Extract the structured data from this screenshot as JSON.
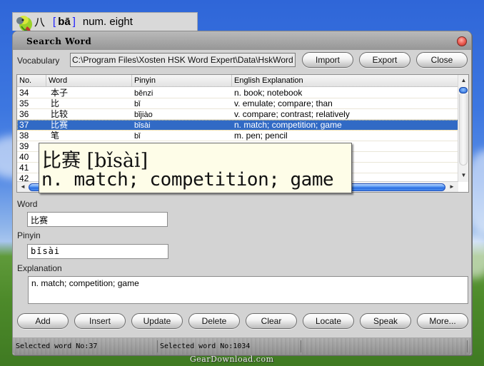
{
  "title_strip": {
    "hanzi": "八",
    "pinyin": "bā",
    "open_bracket": "[",
    "close_bracket": "]",
    "definition": "num. eight",
    "icon": "parrot-icon"
  },
  "window": {
    "title": "Search Word",
    "close_icon": "close-orb-icon"
  },
  "vocabulary": {
    "label": "Vocabulary",
    "path": "C:\\Program Files\\Xosten HSK Word Expert\\Data\\HskWord"
  },
  "toolbar": {
    "import_label": "Import",
    "export_label": "Export",
    "close_label": "Close"
  },
  "list": {
    "columns": [
      "No.",
      "Word",
      "Pinyin",
      "English Explanation"
    ],
    "rows": [
      {
        "no": "34",
        "word": "本子",
        "pinyin": "běnzi",
        "explanation": "n. book; notebook"
      },
      {
        "no": "35",
        "word": "比",
        "pinyin": "bǐ",
        "explanation": "v. emulate; compare; than"
      },
      {
        "no": "36",
        "word": "比较",
        "pinyin": "bǐjiào",
        "explanation": "v. compare; contrast; relatively"
      },
      {
        "no": "37",
        "word": "比赛",
        "pinyin": "bǐsài",
        "explanation": "n. match; competition; game",
        "selected": true
      },
      {
        "no": "38",
        "word": "笔",
        "pinyin": "bǐ",
        "explanation": "m. pen; pencil"
      },
      {
        "no": "39",
        "word": "",
        "pinyin": "",
        "explanation": ""
      },
      {
        "no": "40",
        "word": "",
        "pinyin": "",
        "explanation": ""
      },
      {
        "no": "41",
        "word": "",
        "pinyin": "",
        "explanation": ""
      },
      {
        "no": "42",
        "word": "",
        "pinyin": "",
        "explanation": ""
      }
    ],
    "scroll_up_glyph": "▲",
    "scroll_down_glyph": "▼",
    "scroll_left_glyph": "◄",
    "scroll_right_glyph": "►"
  },
  "tooltip": {
    "line1": "比赛 [bǐsài]",
    "line2": "n. match; competition; game"
  },
  "form": {
    "word_label": "Word",
    "word_value": "比赛",
    "pinyin_label": "Pinyin",
    "pinyin_value": "bǐsài",
    "explanation_label": "Explanation",
    "explanation_value": "n. match; competition; game"
  },
  "actions": {
    "add": "Add",
    "insert": "Insert",
    "update": "Update",
    "delete": "Delete",
    "clear": "Clear",
    "locate": "Locate",
    "speak": "Speak",
    "more": "More..."
  },
  "status": {
    "panel1": "Selected word No:37",
    "panel2": "Selected word No:1034",
    "panel3": ""
  },
  "watermark": "GearDownload.com",
  "colors": {
    "selection": "#316ac5",
    "tooltip_bg": "#fefde8",
    "bracket_blue": "#1a1aff"
  }
}
